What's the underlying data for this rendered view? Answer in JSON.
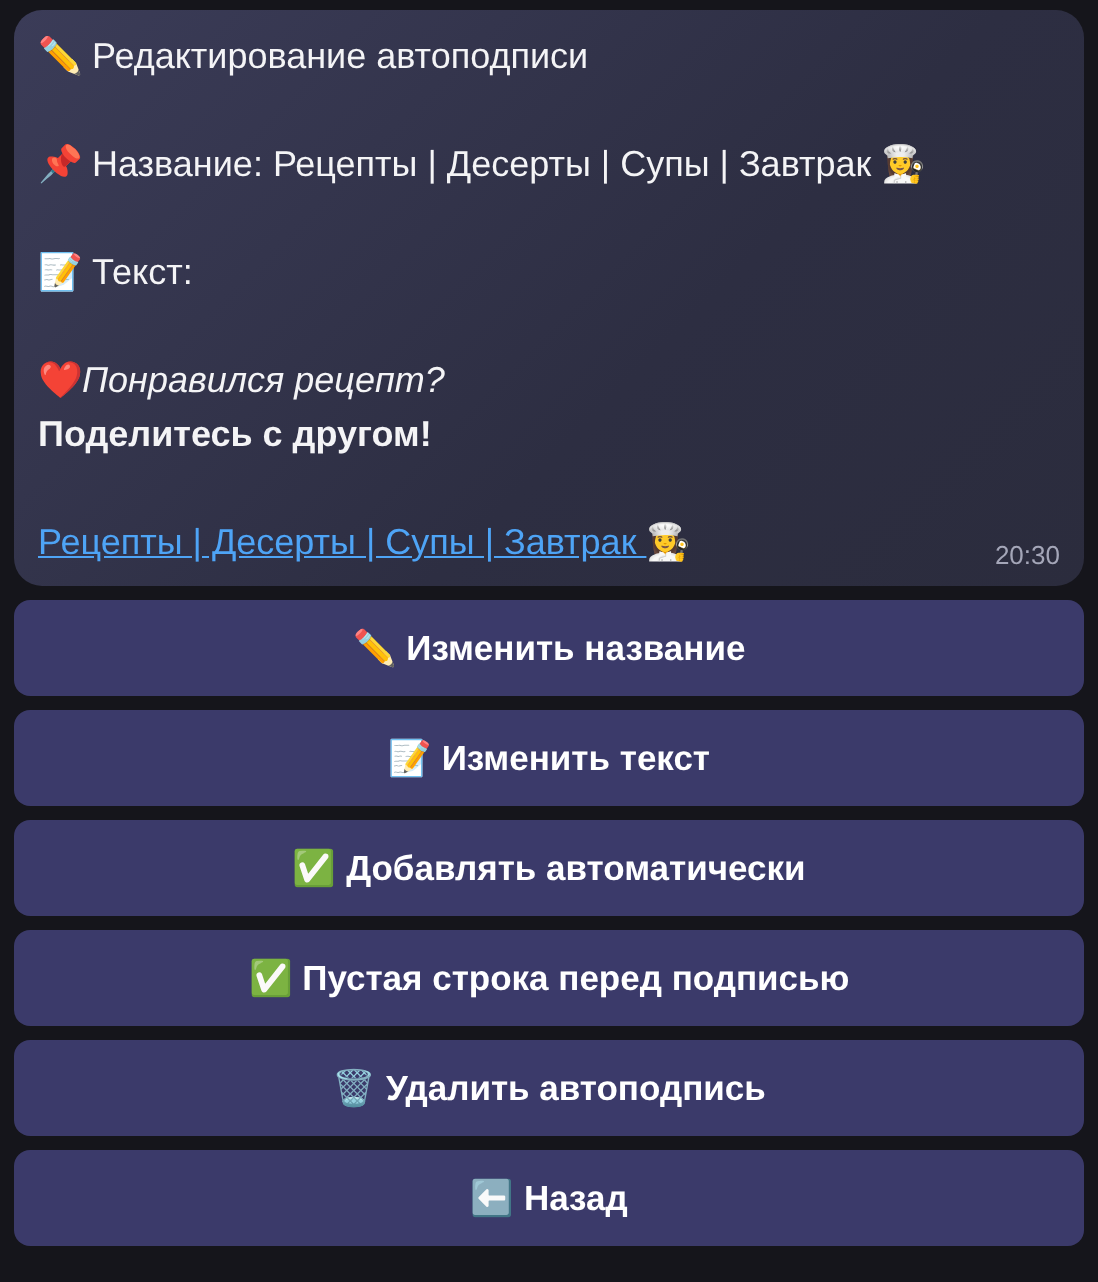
{
  "message": {
    "paragraphs": [
      [
        {
          "kind": "plain",
          "text": "✏️ Редактирование автоподписи"
        }
      ],
      [
        {
          "kind": "plain",
          "text": "📌 Название: Рецепты | Десерты | Супы | Завтрак 👩‍🍳"
        }
      ],
      [
        {
          "kind": "plain",
          "text": "📝 Текст:"
        }
      ],
      [
        {
          "kind": "plain",
          "text": "❤️*Понравился рецепт?*"
        },
        {
          "kind": "bold",
          "text": "Поделитесь с другом!"
        }
      ],
      [
        {
          "kind": "link",
          "text": "Рецепты | Десерты | Супы | Завтрак ",
          "suffix": "👩‍🍳"
        }
      ]
    ],
    "time": "20:30"
  },
  "buttons": [
    "✏️ Изменить название",
    "📝 Изменить текст",
    "✅ Добавлять автоматически",
    "✅ Пустая строка перед подписью",
    "🗑️ Удалить автоподпись",
    "⬅️ Назад"
  ]
}
